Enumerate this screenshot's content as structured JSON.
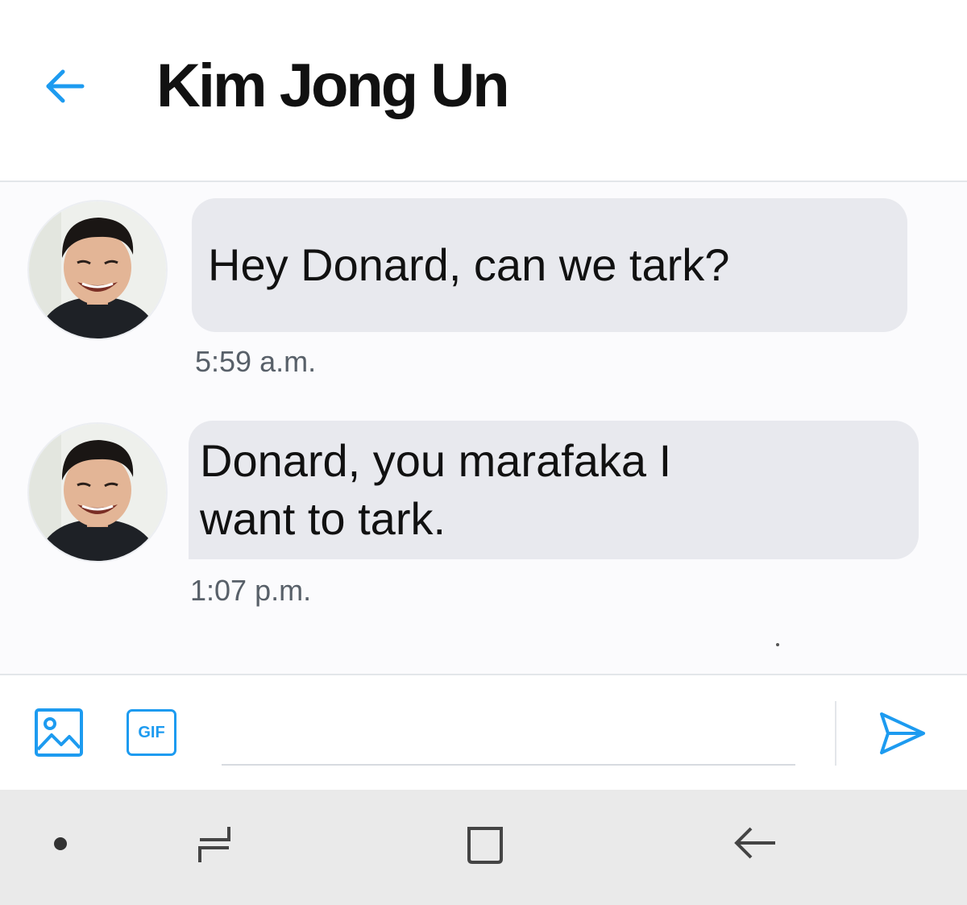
{
  "header": {
    "title": "Kim Jong Un",
    "back_icon": "arrow-left-icon"
  },
  "colors": {
    "accent": "#1d9bf0",
    "bubble": "#e8e9ee",
    "timestamp": "#586069",
    "navbar": "#eaeaea"
  },
  "messages": [
    {
      "avatar": "contact-avatar",
      "lines": [
        "Hey Donard, can we tark?"
      ],
      "timestamp": "5:59 a.m."
    },
    {
      "avatar": "contact-avatar",
      "lines": [
        "Donard, you marafaka I",
        "want to tark."
      ],
      "timestamp": "1:07 p.m."
    }
  ],
  "composer": {
    "image_icon": "image-icon",
    "gif_label": "GIF",
    "input_value": "",
    "placeholder": "",
    "send_icon": "send-icon"
  },
  "navbar": {
    "items": [
      "dot-icon",
      "recents-icon",
      "home-icon",
      "back-icon"
    ]
  }
}
